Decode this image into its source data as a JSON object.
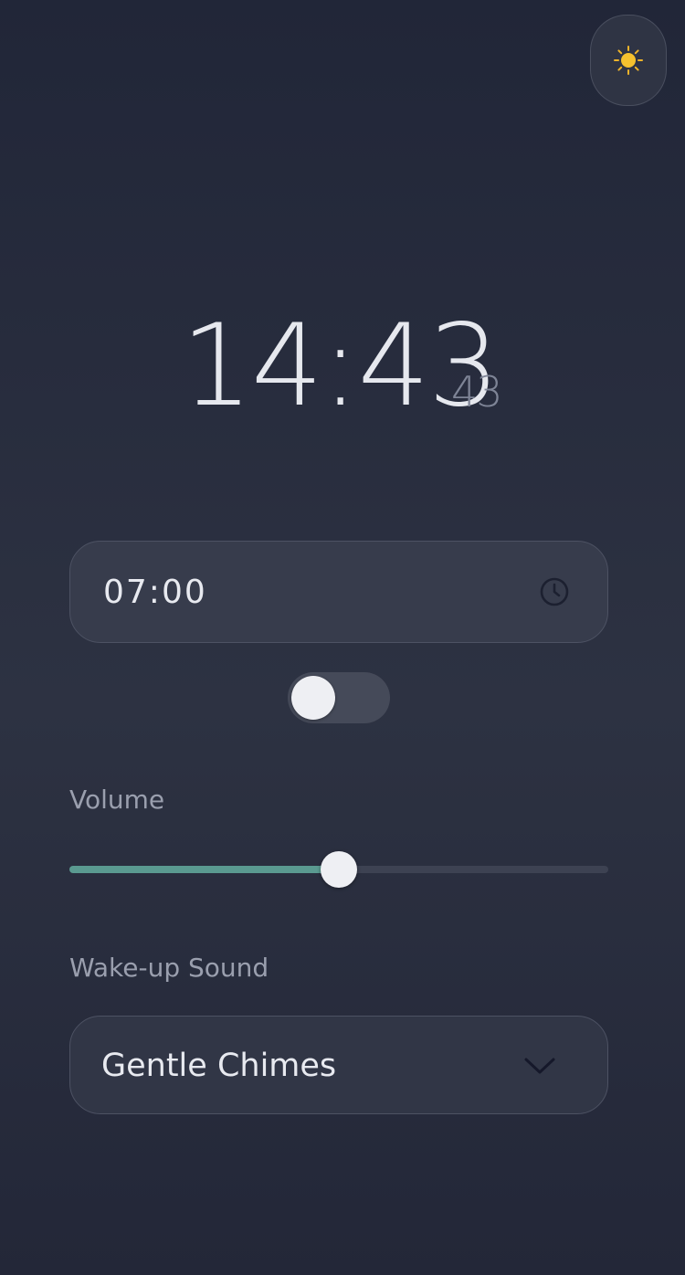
{
  "theme_toggle": {
    "icon": "sun-icon",
    "emoji": "☀️"
  },
  "clock": {
    "hours_minutes": "14:43",
    "seconds": "43"
  },
  "alarm": {
    "time_value": "07:00",
    "icon": "clock-icon",
    "enabled": false
  },
  "volume": {
    "label": "Volume",
    "level": 0.5
  },
  "wake_sound": {
    "label": "Wake-up Sound",
    "selected": "Gentle Chimes",
    "icon": "chevron-down-icon"
  },
  "colors": {
    "accent": "#5a9a90",
    "background": "#262b3c",
    "sun": "#f5c12e"
  }
}
